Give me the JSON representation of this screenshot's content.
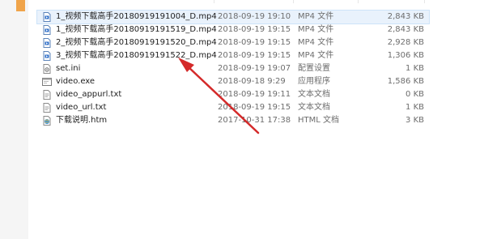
{
  "columns": {
    "date_fragment": "",
    "type_fragment": "",
    "size_fragment": ""
  },
  "files": [
    {
      "name": "1_视频下载高手20180919191004_D.mp4",
      "date": "2018-09-19 19:10",
      "type": "MP4 文件",
      "size": "2,843 KB",
      "icon": "mp4-file-icon",
      "selected": true
    },
    {
      "name": "1_视频下载高手20180919191519_D.mp4",
      "date": "2018-09-19 19:15",
      "type": "MP4 文件",
      "size": "2,843 KB",
      "icon": "mp4-file-icon",
      "selected": false
    },
    {
      "name": "2_视频下载高手20180919191520_D.mp4",
      "date": "2018-09-19 19:15",
      "type": "MP4 文件",
      "size": "2,928 KB",
      "icon": "mp4-file-icon",
      "selected": false
    },
    {
      "name": "3_视频下载高手20180919191522_D.mp4",
      "date": "2018-09-19 19:15",
      "type": "MP4 文件",
      "size": "1,306 KB",
      "icon": "mp4-file-icon",
      "selected": false
    },
    {
      "name": "set.ini",
      "date": "2018-09-19 19:07",
      "type": "配置设置",
      "size": "1 KB",
      "icon": "settings-file-icon",
      "selected": false
    },
    {
      "name": "video.exe",
      "date": "2018-09-18 9:29",
      "type": "应用程序",
      "size": "1,586 KB",
      "icon": "application-icon",
      "selected": false
    },
    {
      "name": "video_appurl.txt",
      "date": "2018-09-19 19:11",
      "type": "文本文档",
      "size": "0 KB",
      "icon": "text-file-icon",
      "selected": false
    },
    {
      "name": "video_url.txt",
      "date": "2018-09-19 19:15",
      "type": "文本文档",
      "size": "1 KB",
      "icon": "text-file-icon",
      "selected": false
    },
    {
      "name": "下载说明.htm",
      "date": "2017-10-31 17:38",
      "type": "HTML 文档",
      "size": "3 KB",
      "icon": "html-file-icon",
      "selected": false
    }
  ],
  "colors": {
    "selected_bg": "#e9f2fc",
    "arrow": "#d42a2a",
    "accent": "#f0a44a"
  }
}
